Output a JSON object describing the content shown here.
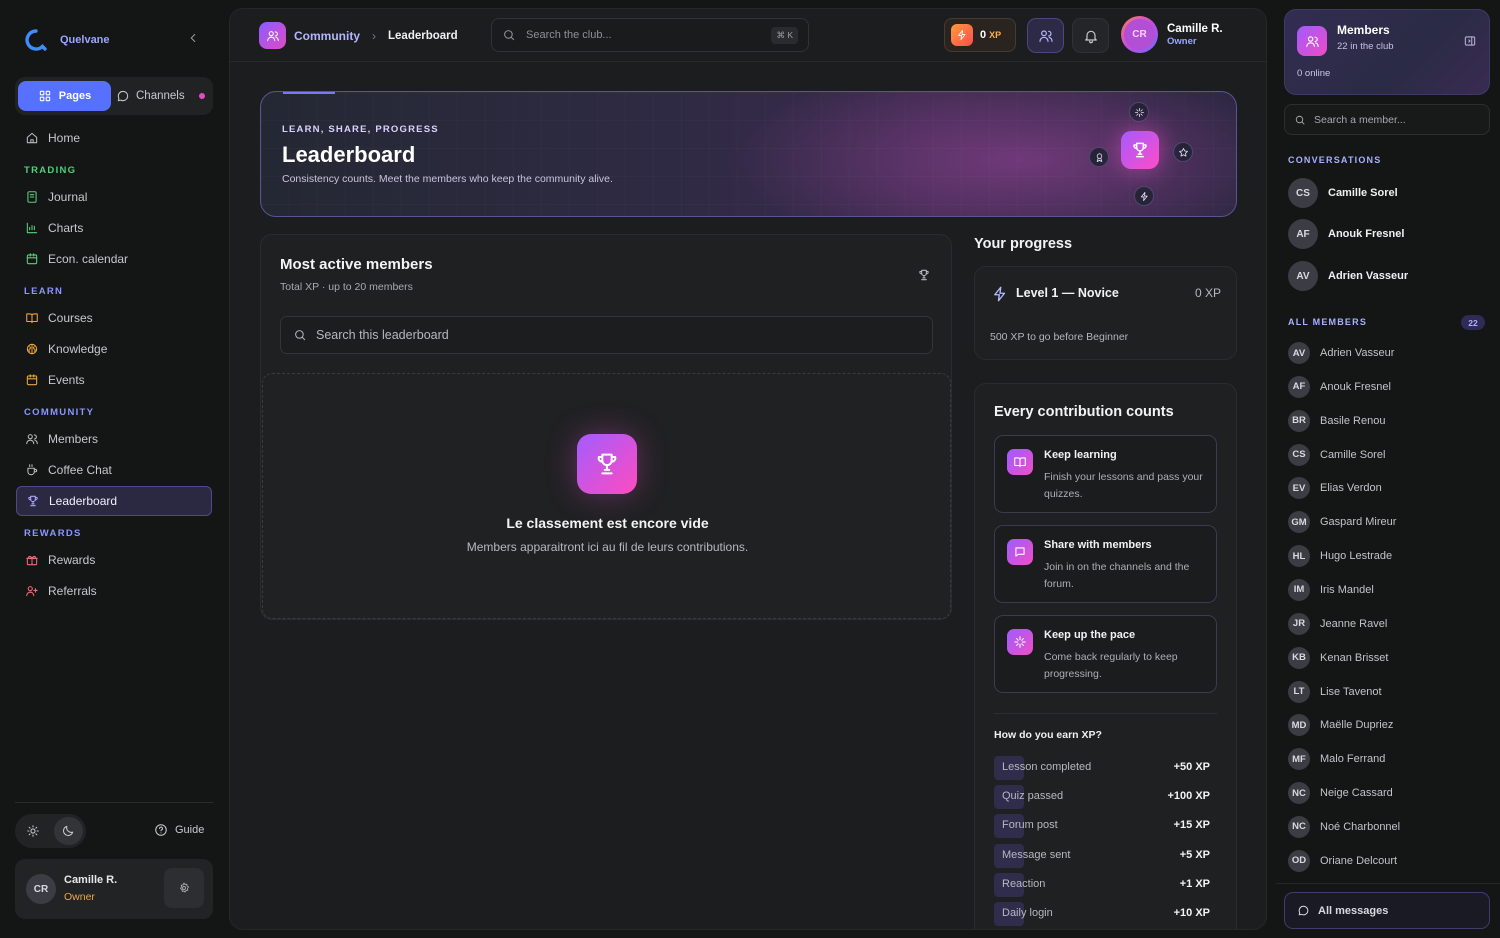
{
  "brand": {
    "name": "Quelvane"
  },
  "switcher": {
    "pages": "Pages",
    "channels": "Channels"
  },
  "nav": {
    "home": "Home",
    "sections": {
      "trading": "TRADING",
      "learn": "LEARN",
      "community": "COMMUNITY",
      "rewards": "REWARDS"
    },
    "trading": [
      "Journal",
      "Charts",
      "Econ. calendar"
    ],
    "learn": [
      "Courses",
      "Knowledge",
      "Events"
    ],
    "community": [
      "Members",
      "Coffee Chat",
      "Leaderboard"
    ],
    "rewards": [
      "Rewards",
      "Referrals"
    ]
  },
  "footer": {
    "guide": "Guide",
    "user": {
      "initials": "CR",
      "name": "Camille R.",
      "role": "Owner"
    }
  },
  "topbar": {
    "breadcrumb": [
      "Community",
      "Leaderboard"
    ],
    "search_placeholder": "Search the club...",
    "shortcut": "⌘ K",
    "xp_value": "0",
    "xp_label": "XP",
    "user": {
      "initials": "CR",
      "name": "Camille R.",
      "role": "Owner"
    }
  },
  "hero": {
    "kicker": "LEARN, SHARE, PROGRESS",
    "title": "Leaderboard",
    "subtitle": "Consistency counts. Meet the members who keep the community alive."
  },
  "leaderboard": {
    "title": "Most active members",
    "subtitle": "Total XP · up to 20 members",
    "search_placeholder": "Search this leaderboard",
    "empty_title": "Le classement est encore vide",
    "empty_text": "Members apparaitront ici au fil de leurs contributions."
  },
  "progress": {
    "title": "Your progress",
    "level": "Level 1 — Novice",
    "xp": "0 XP",
    "next": "500 XP to go before Beginner"
  },
  "contrib": {
    "title": "Every contribution counts",
    "tips": [
      {
        "title": "Keep learning",
        "text": "Finish your lessons and pass your quizzes.",
        "icon": "book-icon"
      },
      {
        "title": "Share with members",
        "text": "Join in on the channels and the forum.",
        "icon": "chat-icon"
      },
      {
        "title": "Keep up the pace",
        "text": "Come back regularly to keep progressing.",
        "icon": "sparkle-icon"
      }
    ],
    "earn_title": "How do you earn XP?",
    "earn": [
      {
        "label": "Lesson completed",
        "value": "+50 XP"
      },
      {
        "label": "Quiz passed",
        "value": "+100 XP"
      },
      {
        "label": "Forum post",
        "value": "+15 XP"
      },
      {
        "label": "Message sent",
        "value": "+5 XP"
      },
      {
        "label": "Reaction",
        "value": "+1 XP"
      },
      {
        "label": "Daily login",
        "value": "+10 XP"
      }
    ]
  },
  "members": {
    "title": "Members",
    "count": "22 in the club",
    "online": "0 online",
    "search_placeholder": "Search a member...",
    "conversations_label": "CONVERSATIONS",
    "conversations": [
      {
        "initials": "CS",
        "name": "Camille Sorel"
      },
      {
        "initials": "AF",
        "name": "Anouk Fresnel"
      },
      {
        "initials": "AV",
        "name": "Adrien Vasseur"
      }
    ],
    "all_label": "ALL MEMBERS",
    "all_count": "22",
    "list": [
      {
        "initials": "AV",
        "name": "Adrien Vasseur"
      },
      {
        "initials": "AF",
        "name": "Anouk Fresnel"
      },
      {
        "initials": "BR",
        "name": "Basile Renou"
      },
      {
        "initials": "CS",
        "name": "Camille Sorel"
      },
      {
        "initials": "EV",
        "name": "Elias Verdon"
      },
      {
        "initials": "GM",
        "name": "Gaspard Mireur"
      },
      {
        "initials": "HL",
        "name": "Hugo Lestrade"
      },
      {
        "initials": "IM",
        "name": "Iris Mandel"
      },
      {
        "initials": "JR",
        "name": "Jeanne Ravel"
      },
      {
        "initials": "KB",
        "name": "Kenan Brisset"
      },
      {
        "initials": "LT",
        "name": "Lise Tavenot"
      },
      {
        "initials": "MD",
        "name": "Maëlle Dupriez"
      },
      {
        "initials": "MF",
        "name": "Malo Ferrand"
      },
      {
        "initials": "NC",
        "name": "Neige Cassard"
      },
      {
        "initials": "NC",
        "name": "Noé Charbonnel"
      },
      {
        "initials": "OD",
        "name": "Oriane Delcourt"
      }
    ],
    "all_messages": "All messages"
  },
  "colors": {
    "accent": "#5671ff",
    "section_green": "#4fd07a",
    "owner_orange": "#e8a840",
    "gradient_pink": "#f04ec6"
  }
}
